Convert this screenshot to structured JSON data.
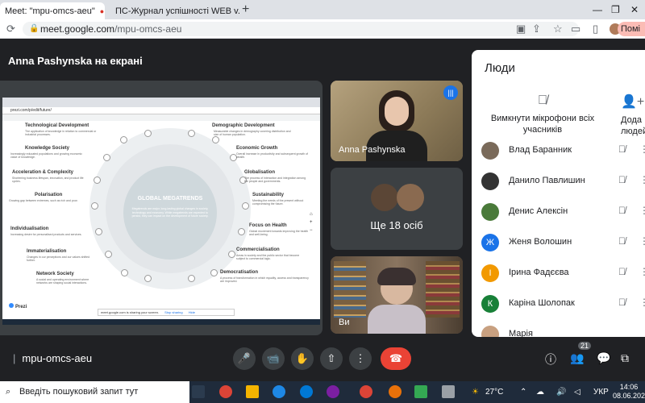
{
  "browser": {
    "tabs": [
      {
        "title": "Meet: \"mpu-omcs-aeu\"",
        "active": true
      },
      {
        "title": "ПС-Журнал успішності WEB v.3",
        "active": false
      }
    ],
    "url_domain": "meet.google.com",
    "url_path": "/mpu-omcs-aeu",
    "profile_label": "Помі"
  },
  "meet": {
    "presenter_label": "Anna Pashynska на екрані",
    "meeting_code": "mpu-omcs-aeu",
    "participant_count_badge": "21",
    "tiles": {
      "speaker_name": "Anna Pashynska",
      "more_label": "Ще 18 осіб",
      "self_label": "Ви"
    }
  },
  "slide": {
    "center_title": "GLOBAL MEGATRENDS",
    "center_text": "Megatrends are major, long-lasting global changes in society, technology and economy. While megatrends are expected to persist, they can impact on the development of future society.",
    "footer_brand": "Prezi",
    "share_notice": "meet.google.com is sharing your screen.",
    "stop_sharing": "Stop sharing",
    "hide": "Hide",
    "mini_url": "prezi.com/p/edit/future/",
    "left_trends": [
      {
        "name": "Technological Development",
        "desc": "The application of knowledge in relation to commercial or industrial processes."
      },
      {
        "name": "Knowledge Society",
        "desc": "Increasingly educated populations and growing economic value of knowledge."
      },
      {
        "name": "Acceleration & Complexity",
        "desc": "Shortening business lifespan, innovation, and product life cycles."
      },
      {
        "name": "Polarisation",
        "desc": "Growing gap between extremes, such as rich and poor."
      },
      {
        "name": "Individualisation",
        "desc": "Increasing desire for personalised products and services."
      },
      {
        "name": "Immaterialisation",
        "desc": "Changes in our perceptions and our values shifted further."
      },
      {
        "name": "Network Society",
        "desc": "A social and operating environment where networks are shaping social interactions."
      }
    ],
    "right_trends": [
      {
        "name": "Demographic Development",
        "desc": "Measurable changes in demography covering distribution and size of human population."
      },
      {
        "name": "Economic Growth",
        "desc": "Overall increase in productivity and subsequent growth of wealth."
      },
      {
        "name": "Globalisation",
        "desc": "The process of interaction and integration among the people and governments."
      },
      {
        "name": "Sustainability",
        "desc": "Meeting the needs of the present without compromising the future."
      },
      {
        "name": "Focus on Health",
        "desc": "Global movement towards improving the health and well-being."
      },
      {
        "name": "Commercialisation",
        "desc": "Areas in society and the public sector that become subject to commercial logic."
      },
      {
        "name": "Democratisation",
        "desc": "A process of transformation in which equality, access and transparency are improved."
      }
    ]
  },
  "people_panel": {
    "title": "Люди",
    "mute_all": "Вимкнути мікрофони всіх учасників",
    "add_people": "Дода людей",
    "participants": [
      {
        "name": "Влад Баранник",
        "initial": "",
        "color": "#7a6a5a"
      },
      {
        "name": "Данило Павлишин",
        "initial": "",
        "color": "#333333"
      },
      {
        "name": "Денис Алексін",
        "initial": "",
        "color": "#4a7a3a"
      },
      {
        "name": "Женя Волошин",
        "initial": "Ж",
        "color": "#1a73e8"
      },
      {
        "name": "Ірина Фадєєва",
        "initial": "І",
        "color": "#f29900"
      },
      {
        "name": "Каріна Шолопак",
        "initial": "К",
        "color": "#188038"
      },
      {
        "name": "Марія",
        "initial": "",
        "color": "#c8a080"
      }
    ]
  },
  "taskbar": {
    "search_placeholder": "Введіть пошуковий запит тут",
    "weather": "27°C",
    "language": "УКР",
    "time": "14:06",
    "date": "08.06.2021"
  }
}
